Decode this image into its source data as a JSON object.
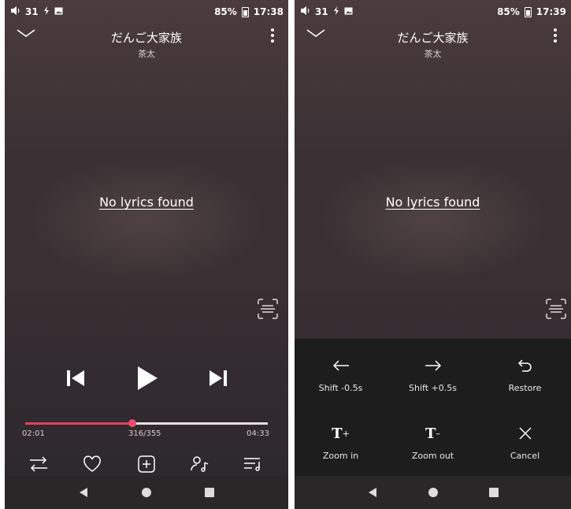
{
  "left_screen": {
    "status": {
      "volume": "31",
      "battery": "85%",
      "time": "17:38"
    },
    "header": {
      "title": "だんご大家族",
      "artist": "茶太"
    },
    "lyrics": {
      "message": "No lyrics found"
    },
    "player": {
      "elapsed": "02:01",
      "position": "316/355",
      "total": "04:33",
      "progress_fraction": 0.443
    }
  },
  "right_screen": {
    "status": {
      "volume": "31",
      "battery": "85%",
      "time": "17:39"
    },
    "header": {
      "title": "だんご大家族",
      "artist": "茶太"
    },
    "lyrics": {
      "message": "No lyrics found"
    },
    "sheet": {
      "shift_back": "Shift -0.5s",
      "shift_forward": "Shift +0.5s",
      "restore": "Restore",
      "zoom_in": "Zoom in",
      "zoom_out": "Zoom out",
      "cancel": "Cancel"
    }
  },
  "colors": {
    "accent": "#f24a6e",
    "sheet_bg": "#1d1d1d",
    "navbar": "#2a2729"
  },
  "icons": [
    "volume-icon",
    "flash-icon",
    "image-icon",
    "battery-icon",
    "collapse-icon",
    "more-icon",
    "scan-icon",
    "previous-icon",
    "play-icon",
    "next-icon",
    "repeat-icon",
    "heart-icon",
    "add-to-playlist-icon",
    "artist-icon",
    "queue-icon",
    "back-nav-icon",
    "home-nav-icon",
    "recents-nav-icon",
    "arrow-left-icon",
    "arrow-right-icon",
    "restore-icon",
    "text-bigger-icon",
    "text-smaller-icon",
    "close-icon"
  ]
}
